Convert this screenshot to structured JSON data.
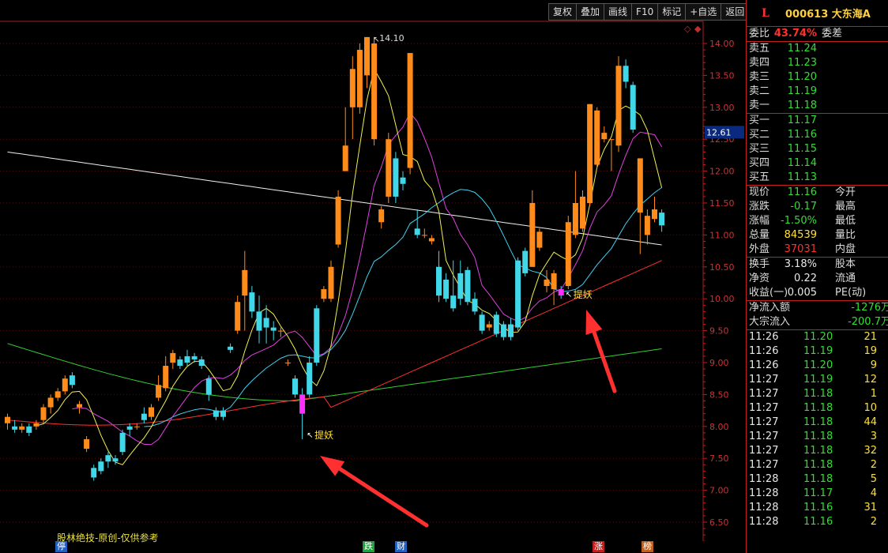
{
  "toolbar": {
    "buttons": [
      "复权",
      "叠加",
      "画线",
      "F10",
      "标记",
      "+自选",
      "返回"
    ]
  },
  "chart": {
    "price_levels": [
      "14.00",
      "13.50",
      "13.00",
      "12.50",
      "12.00",
      "11.50",
      "11.00",
      "10.50",
      "10.00",
      "9.50",
      "9.00",
      "8.50",
      "8.00",
      "7.50",
      "7.00",
      "6.50"
    ],
    "current_price_tag": "12.61",
    "high_label": "14.10",
    "signal_label": "提妖",
    "watermark": "股林绝技-原创-仅供参考",
    "footer_tags": [
      "停",
      "跌",
      "财",
      "涨",
      "榜"
    ],
    "colors": {
      "up": "#ff8c1a",
      "down": "#40d8e8",
      "signal": "#ff30ff",
      "ma5": "#f0f050",
      "ma10": "#e040e0",
      "ma20": "#40d0f0",
      "ma60": "#ff3030",
      "ma120": "#30d030",
      "ma250": "#f0f0f0",
      "arrow": "#ff3030"
    }
  },
  "panel": {
    "logo": "L",
    "stock": "000613 大东海A",
    "wei_bi": {
      "label": "委比",
      "value": "43.74%",
      "label2": "委差"
    },
    "asks": [
      {
        "label": "卖五",
        "price": "11.24"
      },
      {
        "label": "卖四",
        "price": "11.23"
      },
      {
        "label": "卖三",
        "price": "11.20"
      },
      {
        "label": "卖二",
        "price": "11.19"
      },
      {
        "label": "卖一",
        "price": "11.18"
      }
    ],
    "bids": [
      {
        "label": "买一",
        "price": "11.17"
      },
      {
        "label": "买二",
        "price": "11.16"
      },
      {
        "label": "买三",
        "price": "11.15"
      },
      {
        "label": "买四",
        "price": "11.14"
      },
      {
        "label": "买五",
        "price": "11.13"
      }
    ],
    "quote": [
      {
        "label": "现价",
        "value": "11.16",
        "label2": "今开",
        "color": "green"
      },
      {
        "label": "涨跌",
        "value": "-0.17",
        "label2": "最高",
        "color": "green"
      },
      {
        "label": "涨幅",
        "value": "-1.50%",
        "label2": "最低",
        "color": "green"
      },
      {
        "label": "总量",
        "value": "84539",
        "label2": "量比",
        "color": "yellow"
      },
      {
        "label": "外盘",
        "value": "37031",
        "label2": "内盘",
        "color": "red"
      }
    ],
    "finance": [
      {
        "label": "换手",
        "value": "3.18%",
        "label2": "股本"
      },
      {
        "label": "净资",
        "value": "0.22",
        "label2": "流通"
      },
      {
        "label": "收益(一)",
        "value": "0.005",
        "label2": "PE(动)"
      }
    ],
    "flow": [
      {
        "label": "净流入额",
        "value": "-1276万"
      },
      {
        "label": "大宗流入",
        "value": "-200.7万"
      }
    ],
    "ticks": [
      {
        "time": "11:26",
        "price": "11.20",
        "vol": "21"
      },
      {
        "time": "11:26",
        "price": "11.19",
        "vol": "19"
      },
      {
        "time": "11:26",
        "price": "11.20",
        "vol": "9"
      },
      {
        "time": "11:27",
        "price": "11.19",
        "vol": "12"
      },
      {
        "time": "11:27",
        "price": "11.18",
        "vol": "1"
      },
      {
        "time": "11:27",
        "price": "11.18",
        "vol": "10"
      },
      {
        "time": "11:27",
        "price": "11.18",
        "vol": "44"
      },
      {
        "time": "11:27",
        "price": "11.18",
        "vol": "3"
      },
      {
        "time": "11:27",
        "price": "11.18",
        "vol": "32"
      },
      {
        "time": "11:27",
        "price": "11.18",
        "vol": "2"
      },
      {
        "time": "11:28",
        "price": "11.18",
        "vol": "5"
      },
      {
        "time": "11:28",
        "price": "11.17",
        "vol": "4"
      },
      {
        "time": "11:28",
        "price": "11.16",
        "vol": "31"
      },
      {
        "time": "11:28",
        "price": "11.16",
        "vol": "2"
      }
    ]
  },
  "candles": [
    [
      8.05,
      8.15,
      7.95,
      8.2
    ],
    [
      8.0,
      7.95,
      7.9,
      8.1
    ],
    [
      7.95,
      8.0,
      7.9,
      8.05
    ],
    [
      8.0,
      7.9,
      7.85,
      8.05
    ],
    [
      8.0,
      8.05,
      7.95,
      8.1
    ],
    [
      8.1,
      8.3,
      8.05,
      8.35
    ],
    [
      8.3,
      8.45,
      8.2,
      8.5
    ],
    [
      8.45,
      8.55,
      8.4,
      8.6
    ],
    [
      8.55,
      8.75,
      8.5,
      8.8
    ],
    [
      8.8,
      8.65,
      8.6,
      8.85
    ],
    [
      8.3,
      8.35,
      8.2,
      8.4
    ],
    [
      7.65,
      7.8,
      7.6,
      7.85
    ],
    [
      7.35,
      7.2,
      7.15,
      7.4
    ],
    [
      7.45,
      7.3,
      7.25,
      7.5
    ],
    [
      7.55,
      7.45,
      7.35,
      7.6
    ],
    [
      7.5,
      7.45,
      7.4,
      7.55
    ],
    [
      7.9,
      7.6,
      7.55,
      7.95
    ],
    [
      8.0,
      7.95,
      7.85,
      8.05
    ],
    [
      8.0,
      8.0,
      7.95,
      8.05
    ],
    [
      8.2,
      8.1,
      8.05,
      8.3
    ],
    [
      8.15,
      8.3,
      8.1,
      8.35
    ],
    [
      8.45,
      8.65,
      8.4,
      8.8
    ],
    [
      8.6,
      8.95,
      8.55,
      9.1
    ],
    [
      9.0,
      9.15,
      8.9,
      9.2
    ],
    [
      9.05,
      8.95,
      8.9,
      9.1
    ],
    [
      9.1,
      9.0,
      8.95,
      9.2
    ],
    [
      9.1,
      9.05,
      9.0,
      9.15
    ],
    [
      9.05,
      8.95,
      8.9,
      9.1
    ],
    [
      8.75,
      8.5,
      8.4,
      8.8
    ],
    [
      8.25,
      8.15,
      8.1,
      8.3
    ],
    [
      8.25,
      8.15,
      8.1,
      8.3
    ],
    [
      9.25,
      9.2,
      9.15,
      9.3
    ],
    [
      9.5,
      9.95,
      9.45,
      10.05
    ],
    [
      10.05,
      10.45,
      9.5,
      10.75
    ],
    [
      10.1,
      9.8,
      9.7,
      10.2
    ],
    [
      9.8,
      9.5,
      9.3,
      10.05
    ],
    [
      9.7,
      9.55,
      9.3,
      9.9
    ],
    [
      9.55,
      9.5,
      9.35,
      9.65
    ],
    [
      9.5,
      9.5,
      9.4,
      9.55
    ],
    [
      9.0,
      9.0,
      8.95,
      9.05
    ],
    [
      8.75,
      8.5,
      8.45,
      8.8
    ],
    [
      8.5,
      8.2,
      7.8,
      8.6
    ],
    [
      9.0,
      8.5,
      8.45,
      9.1
    ],
    [
      9.85,
      9.0,
      8.95,
      9.9
    ],
    [
      10.0,
      10.15,
      9.95,
      10.2
    ],
    [
      10.0,
      10.5,
      9.95,
      10.6
    ],
    [
      10.85,
      11.6,
      10.8,
      11.7
    ],
    [
      12.0,
      12.4,
      12.0,
      13.0
    ],
    [
      13.0,
      13.6,
      12.5,
      13.8
    ],
    [
      13.0,
      13.9,
      12.9,
      14.0
    ],
    [
      13.5,
      14.1,
      13.3,
      14.1
    ],
    [
      12.5,
      14.0,
      12.4,
      14.1
    ],
    [
      11.2,
      11.4,
      11.1,
      11.45
    ],
    [
      11.6,
      12.5,
      11.5,
      12.6
    ],
    [
      12.2,
      11.6,
      11.5,
      12.3
    ],
    [
      11.9,
      11.8,
      11.7,
      12.0
    ],
    [
      12.05,
      13.85,
      11.95,
      13.85
    ],
    [
      11.1,
      11.0,
      10.95,
      11.4
    ],
    [
      11.0,
      11.0,
      10.95,
      11.1
    ],
    [
      10.9,
      10.95,
      10.85,
      11.0
    ],
    [
      10.5,
      10.05,
      9.95,
      10.75
    ],
    [
      10.3,
      10.0,
      9.95,
      10.4
    ],
    [
      10.05,
      9.85,
      9.8,
      10.6
    ],
    [
      10.4,
      10.0,
      9.9,
      10.6
    ],
    [
      10.45,
      9.95,
      9.9,
      10.5
    ],
    [
      10.0,
      9.8,
      9.75,
      10.1
    ],
    [
      9.75,
      9.5,
      9.45,
      9.8
    ],
    [
      9.55,
      9.6,
      9.5,
      9.65
    ],
    [
      9.75,
      9.45,
      9.4,
      9.8
    ],
    [
      9.6,
      9.4,
      9.35,
      9.65
    ],
    [
      9.6,
      9.4,
      9.35,
      9.7
    ],
    [
      10.6,
      9.55,
      9.5,
      10.65
    ],
    [
      10.75,
      10.4,
      10.35,
      10.8
    ],
    [
      10.5,
      11.5,
      10.5,
      11.7
    ],
    [
      10.8,
      11.05,
      10.75,
      11.1
    ],
    [
      10.2,
      10.3,
      10.1,
      10.45
    ],
    [
      10.15,
      10.4,
      9.9,
      10.45
    ],
    [
      10.15,
      10.05,
      10.0,
      10.2
    ],
    [
      10.2,
      11.2,
      10.15,
      11.3
    ],
    [
      11.0,
      11.5,
      10.95,
      12.0
    ],
    [
      11.1,
      11.6,
      11.05,
      11.7
    ],
    [
      11.5,
      13.05,
      11.45,
      13.05
    ],
    [
      12.1,
      12.95,
      12.05,
      13.0
    ],
    [
      12.5,
      12.6,
      12.45,
      12.7
    ],
    [
      12.5,
      12.5,
      12.0,
      12.5
    ],
    [
      12.4,
      13.65,
      12.3,
      13.8
    ],
    [
      13.65,
      13.4,
      13.3,
      13.75
    ],
    [
      13.35,
      12.65,
      12.6,
      13.4
    ],
    [
      11.35,
      12.2,
      10.7,
      12.2
    ],
    [
      11.0,
      11.3,
      10.85,
      11.4
    ],
    [
      11.25,
      11.4,
      11.2,
      11.6
    ],
    [
      11.35,
      11.15,
      11.05,
      11.4
    ]
  ]
}
